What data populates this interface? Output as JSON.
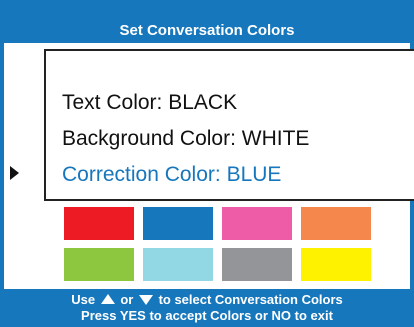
{
  "header": {
    "title": "Set Conversation Colors"
  },
  "settings": [
    {
      "label": "Text Color:",
      "value": "BLACK",
      "selected": false
    },
    {
      "label": "Background Color:",
      "value": "WHITE",
      "selected": false
    },
    {
      "label": "Correction Color:",
      "value": "BLUE",
      "selected": true
    }
  ],
  "swatches": [
    {
      "name": "red",
      "color": "#ed1c24"
    },
    {
      "name": "blue",
      "color": "#1777bd"
    },
    {
      "name": "pink",
      "color": "#ee5ca7"
    },
    {
      "name": "orange",
      "color": "#f5874d"
    },
    {
      "name": "green",
      "color": "#8dc63f"
    },
    {
      "name": "light-blue",
      "color": "#92d8e4"
    },
    {
      "name": "gray",
      "color": "#939598"
    },
    {
      "name": "yellow",
      "color": "#fff200"
    }
  ],
  "footer": {
    "line1_prefix": "Use",
    "line1_mid": "or",
    "line1_suffix": "to select Conversation Colors",
    "line2": "Press YES to accept Colors or NO to exit"
  },
  "colors": {
    "accent": "#1777bd",
    "text": "#111111",
    "background": "#ffffff"
  }
}
